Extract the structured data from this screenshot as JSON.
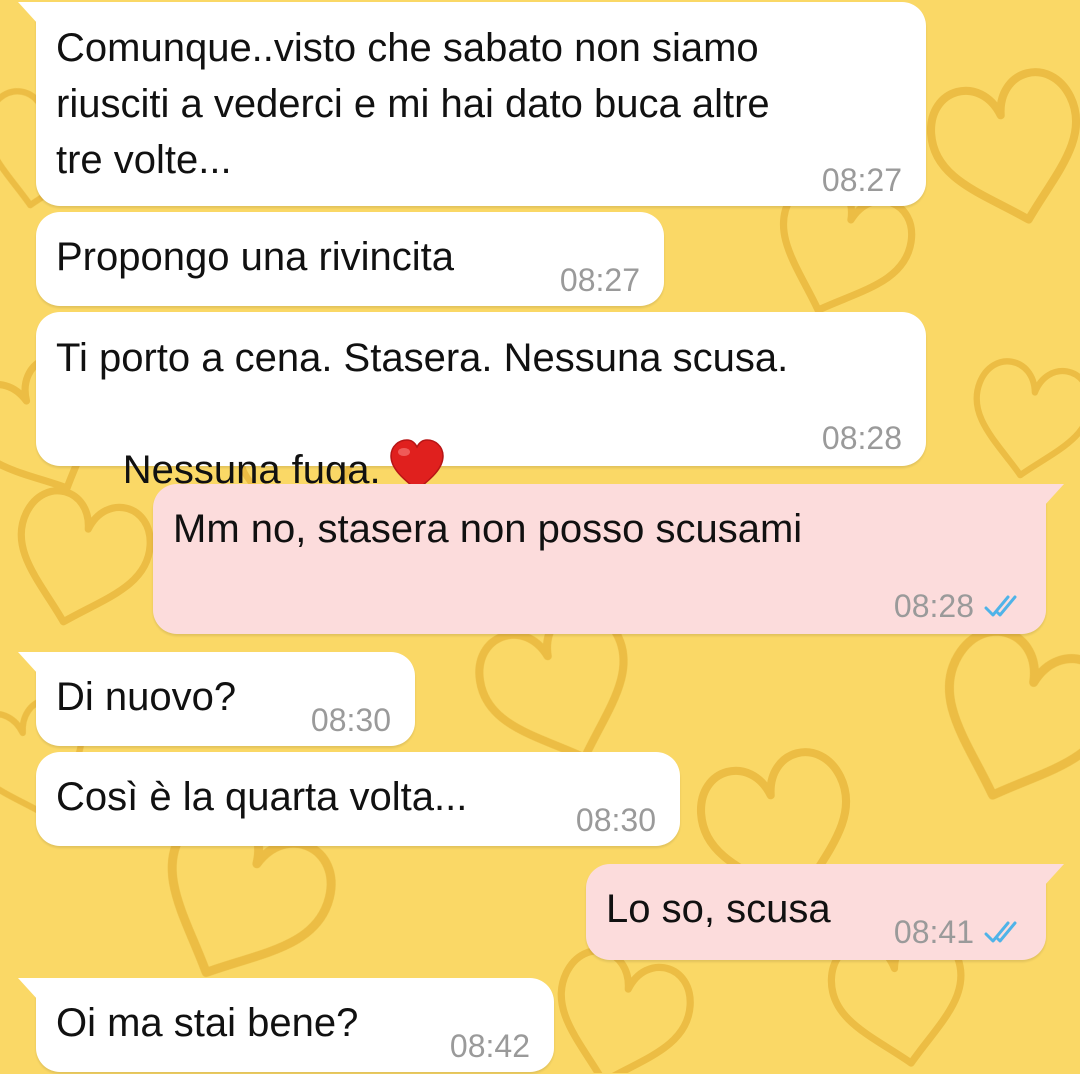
{
  "chat": {
    "messages": [
      {
        "direction": "incoming",
        "lines": [
          "Comunque..visto che sabato non siamo",
          "riusciti a vederci e mi hai dato buca altre",
          "tre volte..."
        ],
        "time": "08:27"
      },
      {
        "direction": "incoming",
        "lines": [
          "Propongo una rivincita"
        ],
        "time": "08:27"
      },
      {
        "direction": "incoming",
        "lines": [
          "Ti porto a cena. Stasera. Nessuna scusa.",
          "Nessuna fuga."
        ],
        "emoji": "red-heart",
        "time": "08:28"
      },
      {
        "direction": "outgoing",
        "lines": [
          "Mm no, stasera non posso scusami"
        ],
        "time": "08:28",
        "status": "read"
      },
      {
        "direction": "incoming",
        "lines": [
          "Di nuovo?"
        ],
        "time": "08:30"
      },
      {
        "direction": "incoming",
        "lines": [
          "Così è la quarta volta..."
        ],
        "time": "08:30"
      },
      {
        "direction": "outgoing",
        "lines": [
          "Lo so, scusa"
        ],
        "time": "08:41",
        "status": "read"
      },
      {
        "direction": "incoming",
        "lines": [
          "Oi ma stai bene?"
        ],
        "time": "08:42"
      }
    ]
  },
  "colors": {
    "wallpaper": "#FAD866",
    "wallpaper_pattern": "#E9B93F",
    "incoming_bubble": "#FFFFFF",
    "outgoing_bubble": "#FCDCDC",
    "read_ticks": "#4FB3E8",
    "timestamp": "#9A9A9A"
  }
}
